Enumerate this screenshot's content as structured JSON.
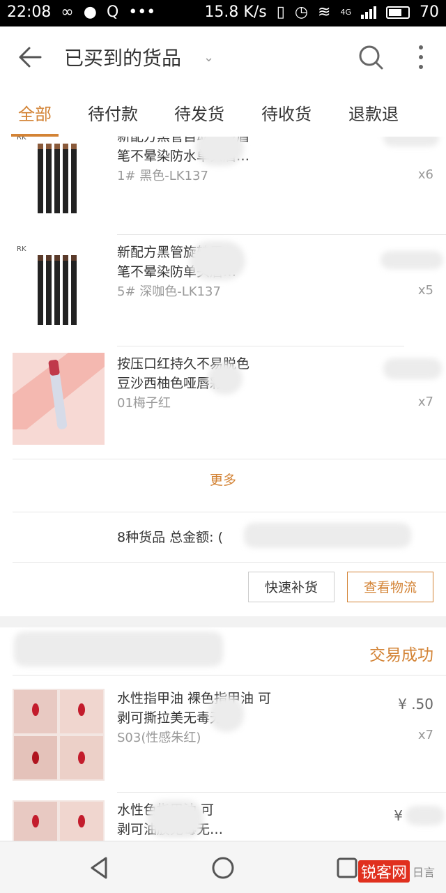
{
  "status_bar": {
    "time": "22:08",
    "speed": "15.8 K/s",
    "network": "4G",
    "battery": "70"
  },
  "header": {
    "title": "已买到的货品"
  },
  "tabs": [
    {
      "label": "全部"
    },
    {
      "label": "待付款"
    },
    {
      "label": "待发货"
    },
    {
      "label": "待收货"
    },
    {
      "label": "退款退"
    }
  ],
  "order1": {
    "items": [
      {
        "name": "新配方黑管自动旋转眉\n笔不晕染防水单头眉…",
        "sku": "1#  黑色-LK137",
        "qty": "x6"
      },
      {
        "name": "新配方黑管旋转眉\n笔不晕染防单头眉…",
        "sku": "5#  深咖色-LK137",
        "qty": "x5"
      },
      {
        "name": "按压口红持久不易脱色\n豆沙西柚色哑唇彩",
        "sku": "01梅子红",
        "qty": "x7"
      }
    ],
    "more_label": "更多",
    "summary": "8种货品  总金额: (",
    "buttons": {
      "restock": "快速补货",
      "logistics": "查看物流"
    }
  },
  "order2": {
    "status": "交易成功",
    "items": [
      {
        "name": "水性指甲油 裸色指甲油 可\n剥可撕拉美无毒无…",
        "sku": "S03(性感朱红)",
        "price": "¥  .50",
        "qty": "x7"
      },
      {
        "name": "水性色指甲油 可\n剥可油胶无毒无…",
        "price": "¥"
      }
    ]
  },
  "watermark": {
    "brand": "锐客网",
    "tail": "日言"
  },
  "colors": {
    "accent": "#d38335",
    "text": "#333333",
    "muted": "#999999"
  },
  "icons": [
    "back-arrow-icon",
    "chevron-down-icon",
    "search-icon",
    "more-vert-icon",
    "nav-back-icon",
    "nav-home-icon",
    "nav-recents-icon"
  ]
}
